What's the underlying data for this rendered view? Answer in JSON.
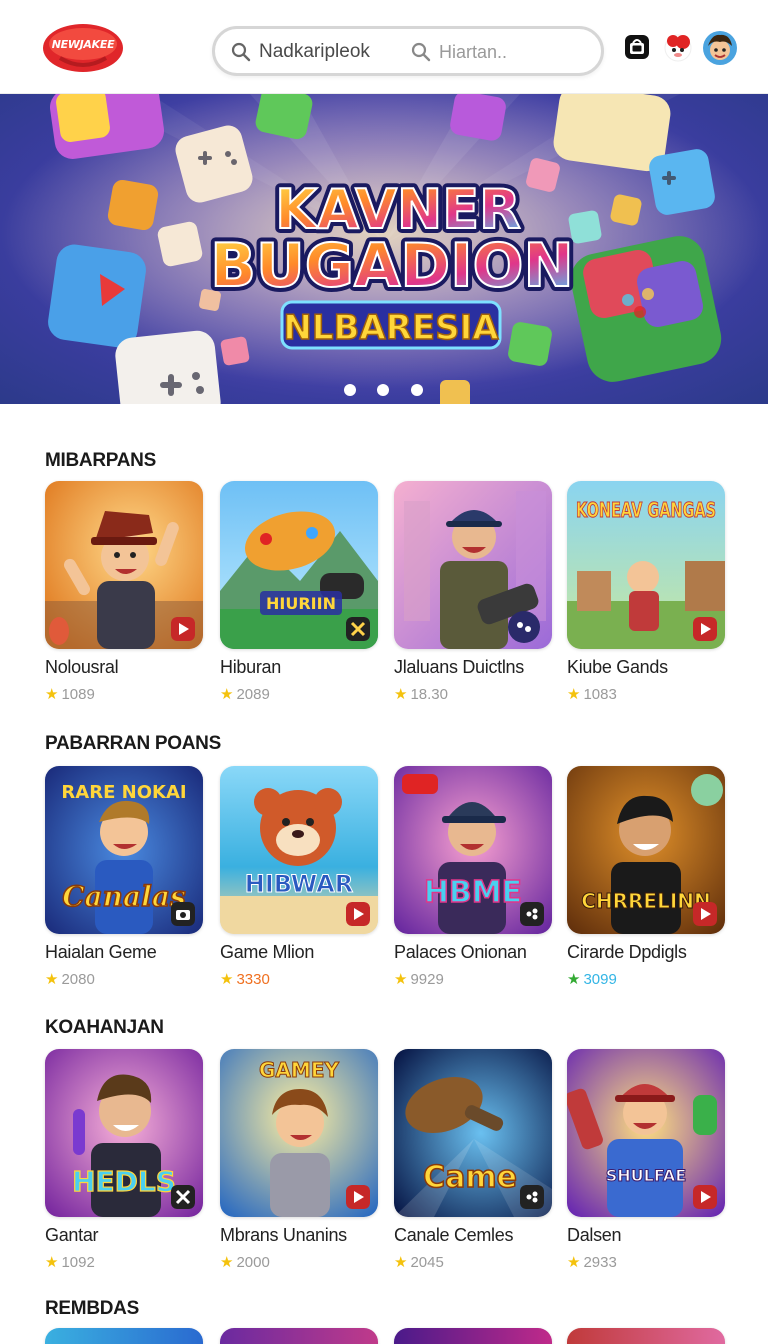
{
  "header": {
    "logo_text": "NEWJAKEE",
    "search_left_text": "Nadkaripleok",
    "search_placeholder": "Hiartan.."
  },
  "banner": {
    "title_line1": "KAVNER",
    "title_line2": "BUGADION",
    "title_line3": "NLBARESIA",
    "active_dot": 0,
    "dot_count": 3
  },
  "sections": [
    {
      "title": "MIBARPANS",
      "items": [
        {
          "title": "Nolousral",
          "rating": "1089",
          "thumb_text": ""
        },
        {
          "title": "Hiburan",
          "rating": "2089",
          "thumb_text": "HIURIIN"
        },
        {
          "title": "Jlaluans Duictlns",
          "rating": "18.30",
          "thumb_text": ""
        },
        {
          "title": "Kiube Gands",
          "rating": "1083",
          "thumb_text": "KONEAV GANGAS"
        }
      ]
    },
    {
      "title": "PABARRAN POANS",
      "items": [
        {
          "title": "Haialan Geme",
          "rating": "2080",
          "thumb_text": "Canalas"
        },
        {
          "title": "Game  Mlion",
          "rating": "3330",
          "thumb_text": "HIBWAR"
        },
        {
          "title": "Palaces Onionan",
          "rating": "9929",
          "thumb_text": "HBME"
        },
        {
          "title": "Cirarde Dpdigls",
          "rating": "3099",
          "thumb_text": "CHRRELINN"
        }
      ]
    },
    {
      "title": "KOAHANJAN",
      "items": [
        {
          "title": "Gantar",
          "rating": "1092",
          "thumb_text": "HEDLS"
        },
        {
          "title": "Mbrans Unanins",
          "rating": "2000",
          "thumb_text": "GAMEY"
        },
        {
          "title": "Canale Cemles",
          "rating": "2045",
          "thumb_text": "Came"
        },
        {
          "title": "Dalsen",
          "rating": "2933",
          "thumb_text": "SHULFAE"
        }
      ]
    },
    {
      "title": "REMBDAS",
      "items": []
    }
  ],
  "colors": {
    "star": "#f4c20d",
    "rating_green": "#33aa33",
    "rating_cyan": "#33b5e5",
    "rating_orange": "#f07020"
  }
}
